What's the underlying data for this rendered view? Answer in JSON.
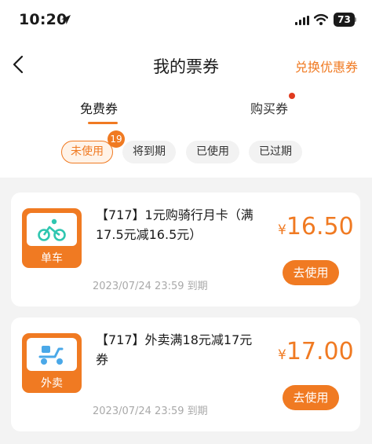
{
  "status_bar": {
    "time": "10:20",
    "battery": "73"
  },
  "nav": {
    "title": "我的票券",
    "exchange_label": "兑换优惠券"
  },
  "tabs": [
    {
      "label": "免费券",
      "active": true
    },
    {
      "label": "购买券",
      "active": false,
      "has_dot": true
    }
  ],
  "filters": {
    "items": [
      {
        "label": "未使用",
        "active": true
      },
      {
        "label": "将到期",
        "active": false
      },
      {
        "label": "已使用",
        "active": false
      },
      {
        "label": "已过期",
        "active": false
      }
    ],
    "unused_count": "19"
  },
  "coupons": [
    {
      "title": "【717】1元购骑行月卡（满17.5元减16.5元）",
      "category": "单车",
      "icon": "bicycle-icon",
      "price_symbol": "¥",
      "price": "16.50",
      "expiry": "2023/07/24 23:59 到期",
      "button": "去使用"
    },
    {
      "title": "【717】外卖满18元减17元券",
      "category": "外卖",
      "icon": "scooter-icon",
      "price_symbol": "¥",
      "price": "17.00",
      "expiry": "2023/07/24 23:59 到期",
      "button": "去使用"
    }
  ],
  "colors": {
    "accent": "#f07a22",
    "badge_dot": "#e03a1e",
    "background": "#f3f3f3"
  }
}
